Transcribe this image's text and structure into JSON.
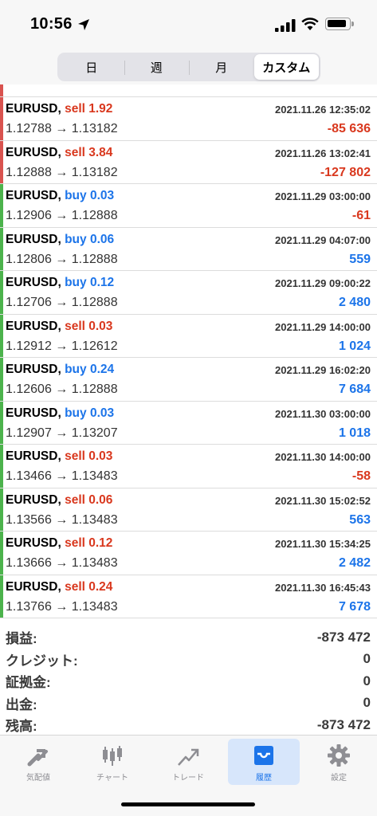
{
  "status": {
    "time": "10:56"
  },
  "segments": [
    {
      "label": "日",
      "active": false
    },
    {
      "label": "週",
      "active": false
    },
    {
      "label": "月",
      "active": false
    },
    {
      "label": "カスタム",
      "active": true
    }
  ],
  "trades": [
    {
      "symbol": "EURUSD,",
      "side": "sell",
      "volume": "1.92",
      "datetime": "2021.11.26 12:35:02",
      "open": "1.12788",
      "close": "1.13182",
      "profit": "-85 636",
      "profit_color": "red",
      "bar_color": "#d9534f"
    },
    {
      "symbol": "EURUSD,",
      "side": "sell",
      "volume": "3.84",
      "datetime": "2021.11.26 13:02:41",
      "open": "1.12888",
      "close": "1.13182",
      "profit": "-127 802",
      "profit_color": "red",
      "bar_color": "#d9534f"
    },
    {
      "symbol": "EURUSD,",
      "side": "buy",
      "volume": "0.03",
      "datetime": "2021.11.29 03:00:00",
      "open": "1.12906",
      "close": "1.12888",
      "profit": "-61",
      "profit_color": "red",
      "bar_color": "#4cb34c"
    },
    {
      "symbol": "EURUSD,",
      "side": "buy",
      "volume": "0.06",
      "datetime": "2021.11.29 04:07:00",
      "open": "1.12806",
      "close": "1.12888",
      "profit": "559",
      "profit_color": "blue",
      "bar_color": "#4cb34c"
    },
    {
      "symbol": "EURUSD,",
      "side": "buy",
      "volume": "0.12",
      "datetime": "2021.11.29 09:00:22",
      "open": "1.12706",
      "close": "1.12888",
      "profit": "2 480",
      "profit_color": "blue",
      "bar_color": "#4cb34c"
    },
    {
      "symbol": "EURUSD,",
      "side": "sell",
      "volume": "0.03",
      "datetime": "2021.11.29 14:00:00",
      "open": "1.12912",
      "close": "1.12612",
      "profit": "1 024",
      "profit_color": "blue",
      "bar_color": "#4cb34c"
    },
    {
      "symbol": "EURUSD,",
      "side": "buy",
      "volume": "0.24",
      "datetime": "2021.11.29 16:02:20",
      "open": "1.12606",
      "close": "1.12888",
      "profit": "7 684",
      "profit_color": "blue",
      "bar_color": "#4cb34c"
    },
    {
      "symbol": "EURUSD,",
      "side": "buy",
      "volume": "0.03",
      "datetime": "2021.11.30 03:00:00",
      "open": "1.12907",
      "close": "1.13207",
      "profit": "1 018",
      "profit_color": "blue",
      "bar_color": "#4cb34c"
    },
    {
      "symbol": "EURUSD,",
      "side": "sell",
      "volume": "0.03",
      "datetime": "2021.11.30 14:00:00",
      "open": "1.13466",
      "close": "1.13483",
      "profit": "-58",
      "profit_color": "red",
      "bar_color": "#4cb34c"
    },
    {
      "symbol": "EURUSD,",
      "side": "sell",
      "volume": "0.06",
      "datetime": "2021.11.30 15:02:52",
      "open": "1.13566",
      "close": "1.13483",
      "profit": "563",
      "profit_color": "blue",
      "bar_color": "#4cb34c"
    },
    {
      "symbol": "EURUSD,",
      "side": "sell",
      "volume": "0.12",
      "datetime": "2021.11.30 15:34:25",
      "open": "1.13666",
      "close": "1.13483",
      "profit": "2 482",
      "profit_color": "blue",
      "bar_color": "#4cb34c"
    },
    {
      "symbol": "EURUSD,",
      "side": "sell",
      "volume": "0.24",
      "datetime": "2021.11.30 16:45:43",
      "open": "1.13766",
      "close": "1.13483",
      "profit": "7 678",
      "profit_color": "blue",
      "bar_color": "#4cb34c"
    }
  ],
  "arrow": "→",
  "summary": [
    {
      "label": "損益:",
      "value": "-873 472"
    },
    {
      "label": "クレジット:",
      "value": "0"
    },
    {
      "label": "証拠金:",
      "value": "0"
    },
    {
      "label": "出金:",
      "value": "0"
    },
    {
      "label": "残高:",
      "value": "-873 472"
    }
  ],
  "tabs": [
    {
      "label": "気配値",
      "icon": "quotes-arrows-icon",
      "active": false
    },
    {
      "label": "チャート",
      "icon": "candlestick-icon",
      "active": false
    },
    {
      "label": "トレード",
      "icon": "trade-chart-icon",
      "active": false
    },
    {
      "label": "履歴",
      "icon": "inbox-tray-icon",
      "active": true
    },
    {
      "label": "設定",
      "icon": "gear-icon",
      "active": false
    }
  ],
  "colors": {
    "sell": "#d9381e",
    "buy": "#1c74e9",
    "accent": "#1c74e9",
    "profit_negative": "#d9381e",
    "profit_positive": "#1c74e9"
  }
}
